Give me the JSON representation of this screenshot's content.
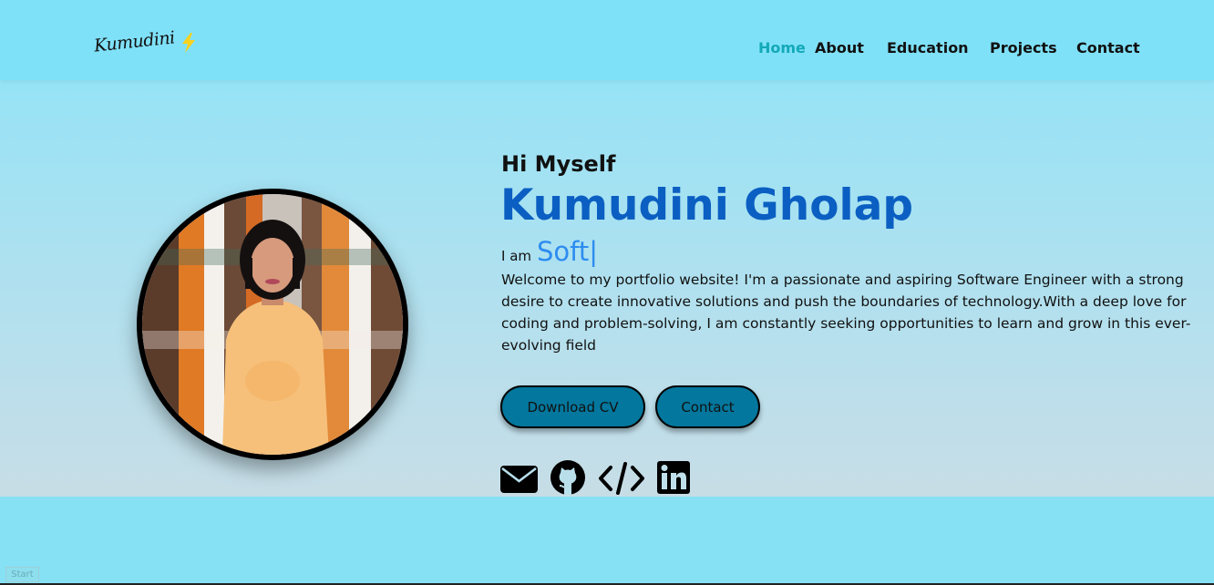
{
  "header": {
    "logo_text": "Kumudini",
    "logo_icon": "lightning-bolt-icon",
    "nav": [
      {
        "label": "Home",
        "active": true
      },
      {
        "label": "About",
        "active": false
      },
      {
        "label": "Education",
        "active": false
      },
      {
        "label": "Projects",
        "active": false
      },
      {
        "label": "Contact",
        "active": false
      }
    ]
  },
  "hero": {
    "greeting": "Hi Myself",
    "name": "Kumudini Gholap",
    "role_prefix": "I am",
    "role_typed": "Soft",
    "role_cursor": "|",
    "description": "Welcome to my portfolio website! I'm a passionate and aspiring Software Engineer with a strong desire to create innovative solutions and push the boundaries of technology.With a deep love for coding and problem-solving, I am constantly seeking opportunities to learn and grow in this ever-evolving field",
    "buttons": {
      "download_cv": "Download CV",
      "contact": "Contact"
    },
    "social_icons": [
      "envelope-icon",
      "github-icon",
      "code-icon",
      "linkedin-icon"
    ]
  },
  "footer": {
    "start_button": "Start"
  },
  "colors": {
    "background": "#86e1f5",
    "header": "#7fe1f8",
    "nav_active": "#12a9b8",
    "name": "#0b5fc2",
    "typed_role": "#2d8cf0",
    "button": "#03779d"
  }
}
